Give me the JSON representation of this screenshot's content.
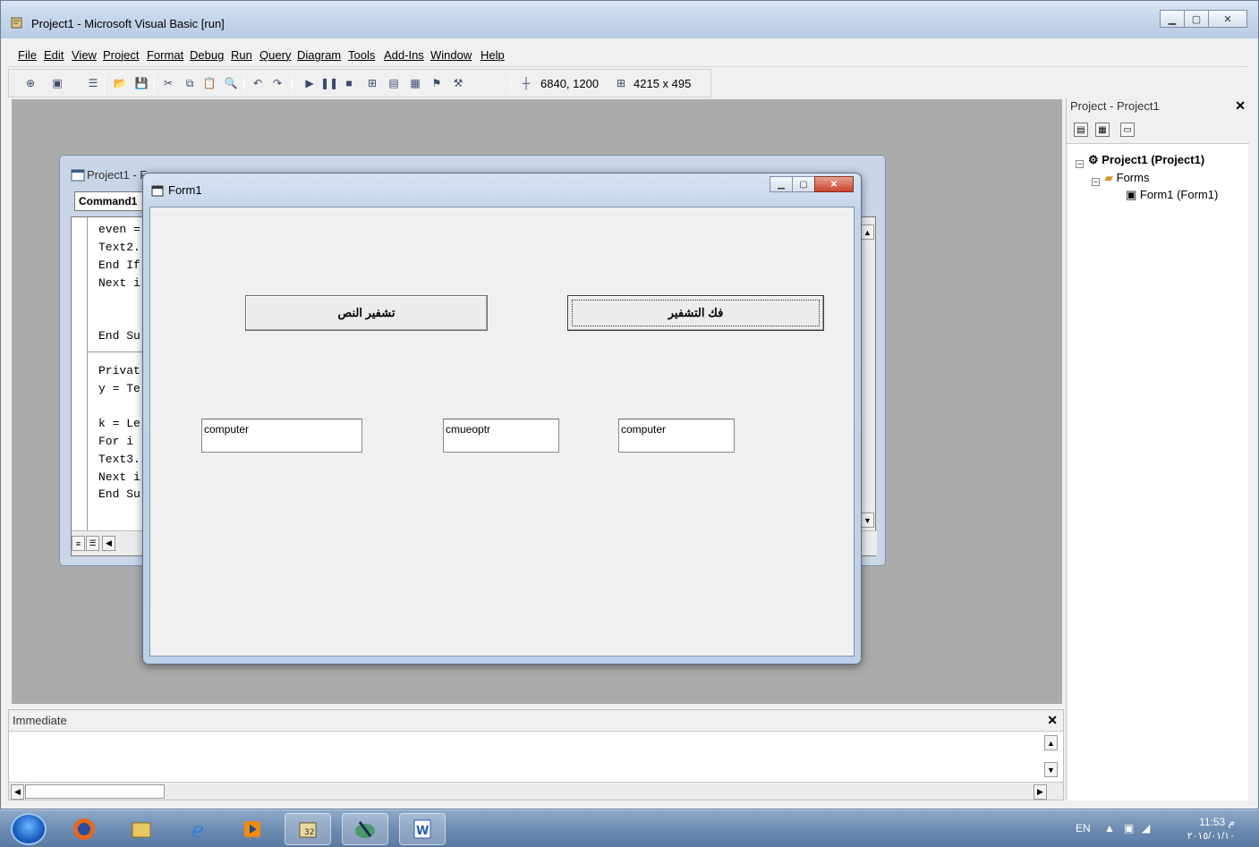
{
  "window": {
    "title": "Project1 - Microsoft Visual Basic [run]"
  },
  "menu": [
    "File",
    "Edit",
    "View",
    "Project",
    "Format",
    "Debug",
    "Run",
    "Query",
    "Diagram",
    "Tools",
    "Add-Ins",
    "Window",
    "Help"
  ],
  "toolbar": {
    "position": "6840, 1200",
    "size": "4215 x 495"
  },
  "code_window": {
    "title": "Project1 - F",
    "object_combo": "Command1",
    "lines": [
      "even =",
      "Text2.",
      "End If",
      "Next i",
      "",
      "",
      "End Su",
      "",
      "Privat",
      "y = Te",
      "",
      "k = Le",
      "For i",
      "Text3.",
      "Next i",
      "End Su"
    ]
  },
  "form1": {
    "title": "Form1",
    "btn_encrypt": "تشفير النص",
    "btn_decrypt": "فك التشفير",
    "text1": "computer",
    "text2": "cmueoptr",
    "text3": "computer"
  },
  "project_explorer": {
    "title": "Project - Project1",
    "root": "Project1 (Project1)",
    "folder": "Forms",
    "item": "Form1 (Form1)"
  },
  "immediate": {
    "title": "Immediate"
  },
  "tray": {
    "lang": "EN",
    "time": "11:53 م",
    "date": "٢٠١٥/٠١/١٠"
  }
}
